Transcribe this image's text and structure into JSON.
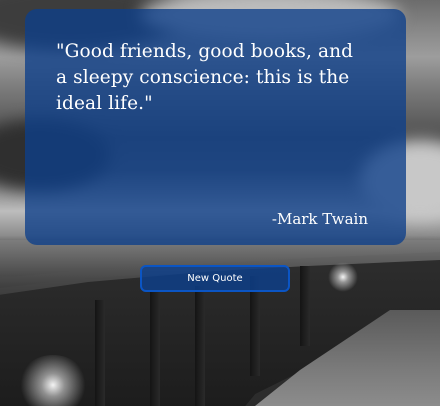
{
  "quote": {
    "text": "\"Good friends, good books, and a sleepy conscience: this is the ideal life.\"",
    "author": "-Mark Twain"
  },
  "controls": {
    "new_quote_label": "New Quote"
  },
  "colors": {
    "card_bg": "#0D3F8B",
    "button_border": "#0B55C4",
    "text": "#FFFFFF"
  }
}
